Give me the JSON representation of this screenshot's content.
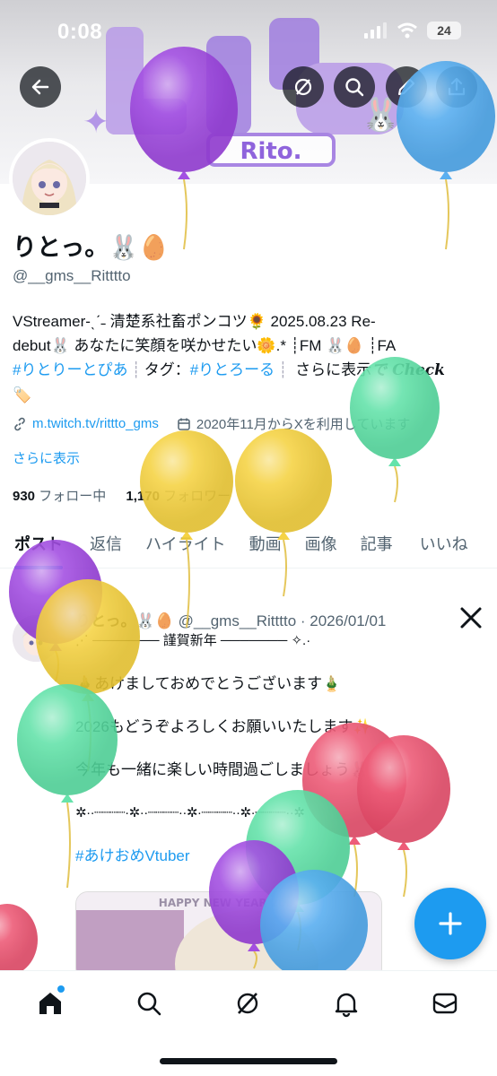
{
  "status_bar": {
    "time": "0:08",
    "battery": "24"
  },
  "banner": {
    "logo_text": "Rito."
  },
  "profile": {
    "display_name": "りとっ。🐰🥚",
    "handle": "@__gms__Ritttto",
    "bio_line1": "VStreamer-ˎˊ˗ 清楚系社畜ポンコツ🌻 2025.08.23 Re-",
    "bio_line2": "debut🐰 あなたに笑顔を咲かせたい🌼.* ┊FM 🐰🥚 ┊FA",
    "bio_tag1": "#りとりーとぴあ",
    "bio_tag_label": "タグ：",
    "bio_tag2": "#りとろーる",
    "bio_more": "さらに表示",
    "bio_check": "で Check",
    "website": "m.twitch.tv/rittto_gms",
    "joined": "2020年11月からXを利用しています",
    "show_more": "さらに表示",
    "following_count": "930",
    "following_label": "フォロー中",
    "followers_count": "1,170",
    "followers_label": "フォロワー"
  },
  "tabs": [
    {
      "label": "ポスト"
    },
    {
      "label": "返信"
    },
    {
      "label": "ハイライト"
    },
    {
      "label": "動画"
    },
    {
      "label": "画像"
    },
    {
      "label": "記事"
    },
    {
      "label": "いいね"
    }
  ],
  "post": {
    "name": "りとっ。🐰🥚",
    "handle": "@__gms__Ritttto",
    "date": "· 2026/01/01",
    "line_title": "⋰ ─────── 謹賀新年 ─────── ✧.·",
    "line_1": "🎍あけましておめでとうございます🎍",
    "line_2": "2026もどうぞよろしくお願いいたします✨",
    "line_3": "今年も一緒に楽しい時間過ごしましょう🐰",
    "line_deco": "✲··┈┈┈┈·✲··┈┈┈┈··✲·┈┈┈┈··✲·┈┈┈┈··✲",
    "hashtag": "#あけおめVtuber",
    "image_text": "HAPPY NEW YEAR 2026"
  },
  "colors": {
    "accent": "#1d9bf0",
    "balloon_purple": "#9b3fe0",
    "balloon_blue": "#4aa8f0",
    "balloon_yellow": "#f5cf33",
    "balloon_green": "#55e0a2",
    "balloon_red": "#ec4b6a"
  },
  "icons": {
    "back": "arrow-left-icon",
    "grok": "grok-icon",
    "search": "search-icon",
    "edit": "pencil-icon",
    "share": "share-icon"
  }
}
